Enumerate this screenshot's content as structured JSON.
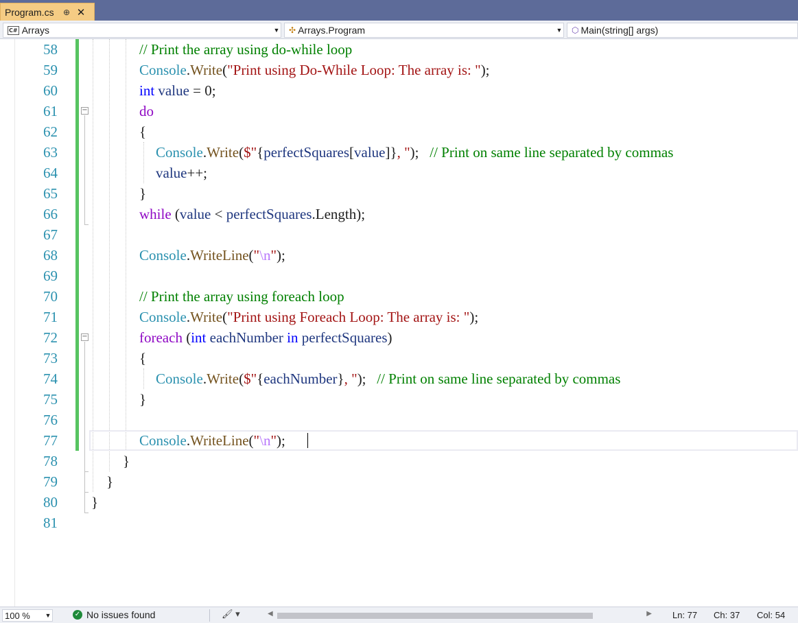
{
  "tab": {
    "title": "Program.cs",
    "pin_icon": "pin-icon",
    "close_glyph": "✕"
  },
  "nav": {
    "project": "Arrays",
    "cls": "Arrays.Program",
    "member": "Main(string[] args)"
  },
  "editor": {
    "lines": [
      {
        "num": "58",
        "indent": 70,
        "tokens": [
          [
            "cmt",
            "// Print the array using do-while loop"
          ]
        ]
      },
      {
        "num": "59",
        "indent": 70,
        "tokens": [
          [
            "type",
            "Console"
          ],
          [
            "punc",
            "."
          ],
          [
            "meth",
            "Write"
          ],
          [
            "punc",
            "("
          ],
          [
            "str",
            "\"Print using Do-While Loop: The array is: \""
          ],
          [
            "punc",
            ");"
          ]
        ]
      },
      {
        "num": "60",
        "indent": 70,
        "tokens": [
          [
            "kw",
            "int"
          ],
          [
            "punc",
            " "
          ],
          [
            "var",
            "value"
          ],
          [
            "punc",
            " = 0;"
          ]
        ]
      },
      {
        "num": "61",
        "indent": 70,
        "tokens": [
          [
            "ctl",
            "do"
          ]
        ]
      },
      {
        "num": "62",
        "indent": 70,
        "tokens": [
          [
            "punc",
            "{"
          ]
        ]
      },
      {
        "num": "63",
        "indent": 94,
        "tokens": [
          [
            "type",
            "Console"
          ],
          [
            "punc",
            "."
          ],
          [
            "meth",
            "Write"
          ],
          [
            "punc",
            "("
          ],
          [
            "str",
            "$\""
          ],
          [
            "punc",
            "{"
          ],
          [
            "var",
            "perfectSquares"
          ],
          [
            "punc",
            "["
          ],
          [
            "var",
            "value"
          ],
          [
            "punc",
            "]}"
          ],
          [
            "str",
            ", \""
          ],
          [
            "punc",
            ");   "
          ],
          [
            "cmt",
            "// Print on same line separated by commas"
          ]
        ]
      },
      {
        "num": "64",
        "indent": 94,
        "tokens": [
          [
            "var",
            "value"
          ],
          [
            "punc",
            "++;"
          ]
        ]
      },
      {
        "num": "65",
        "indent": 70,
        "tokens": [
          [
            "punc",
            "}"
          ]
        ]
      },
      {
        "num": "66",
        "indent": 70,
        "tokens": [
          [
            "ctl",
            "while"
          ],
          [
            "punc",
            " ("
          ],
          [
            "var",
            "value"
          ],
          [
            "punc",
            " < "
          ],
          [
            "var",
            "perfectSquares"
          ],
          [
            "punc",
            "."
          ],
          [
            "punc",
            "Length);"
          ]
        ]
      },
      {
        "num": "67",
        "indent": 70,
        "tokens": []
      },
      {
        "num": "68",
        "indent": 70,
        "tokens": [
          [
            "type",
            "Console"
          ],
          [
            "punc",
            "."
          ],
          [
            "meth",
            "WriteLine"
          ],
          [
            "punc",
            "("
          ],
          [
            "str",
            "\""
          ],
          [
            "esc",
            "\\n"
          ],
          [
            "str",
            "\""
          ],
          [
            "punc",
            ");"
          ]
        ]
      },
      {
        "num": "69",
        "indent": 70,
        "tokens": []
      },
      {
        "num": "70",
        "indent": 70,
        "tokens": [
          [
            "cmt",
            "// Print the array using foreach loop"
          ]
        ]
      },
      {
        "num": "71",
        "indent": 70,
        "tokens": [
          [
            "type",
            "Console"
          ],
          [
            "punc",
            "."
          ],
          [
            "meth",
            "Write"
          ],
          [
            "punc",
            "("
          ],
          [
            "str",
            "\"Print using Foreach Loop: The array is: \""
          ],
          [
            "punc",
            ");"
          ]
        ]
      },
      {
        "num": "72",
        "indent": 70,
        "tokens": [
          [
            "ctl",
            "foreach"
          ],
          [
            "punc",
            " ("
          ],
          [
            "kw",
            "int"
          ],
          [
            "punc",
            " "
          ],
          [
            "var",
            "eachNumber"
          ],
          [
            "punc",
            " "
          ],
          [
            "kw",
            "in"
          ],
          [
            "punc",
            " "
          ],
          [
            "var",
            "perfectSquares"
          ],
          [
            "punc",
            ")"
          ]
        ]
      },
      {
        "num": "73",
        "indent": 70,
        "tokens": [
          [
            "punc",
            "{"
          ]
        ]
      },
      {
        "num": "74",
        "indent": 94,
        "tokens": [
          [
            "type",
            "Console"
          ],
          [
            "punc",
            "."
          ],
          [
            "meth",
            "Write"
          ],
          [
            "punc",
            "("
          ],
          [
            "str",
            "$\""
          ],
          [
            "punc",
            "{"
          ],
          [
            "var",
            "eachNumber"
          ],
          [
            "punc",
            "}"
          ],
          [
            "str",
            ", \""
          ],
          [
            "punc",
            ");   "
          ],
          [
            "cmt",
            "// Print on same line separated by commas"
          ]
        ]
      },
      {
        "num": "75",
        "indent": 70,
        "tokens": [
          [
            "punc",
            "}"
          ]
        ]
      },
      {
        "num": "76",
        "indent": 70,
        "tokens": []
      },
      {
        "num": "77",
        "indent": 70,
        "tokens": [
          [
            "type",
            "Console"
          ],
          [
            "punc",
            "."
          ],
          [
            "meth",
            "WriteLine"
          ],
          [
            "punc",
            "("
          ],
          [
            "str",
            "\""
          ],
          [
            "esc",
            "\\n"
          ],
          [
            "str",
            "\""
          ],
          [
            "punc",
            ");"
          ]
        ]
      },
      {
        "num": "78",
        "indent": 46,
        "tokens": [
          [
            "punc",
            "}"
          ]
        ]
      },
      {
        "num": "79",
        "indent": 22,
        "tokens": [
          [
            "punc",
            "}"
          ]
        ]
      },
      {
        "num": "80",
        "indent": 0,
        "tokens": [
          [
            "punc",
            "}"
          ]
        ]
      },
      {
        "num": "81",
        "indent": 0,
        "tokens": []
      }
    ]
  },
  "status": {
    "zoom": "100 %",
    "issues": "No issues found",
    "ln": "Ln: 77",
    "ch": "Ch: 37",
    "col": "Col: 54"
  }
}
